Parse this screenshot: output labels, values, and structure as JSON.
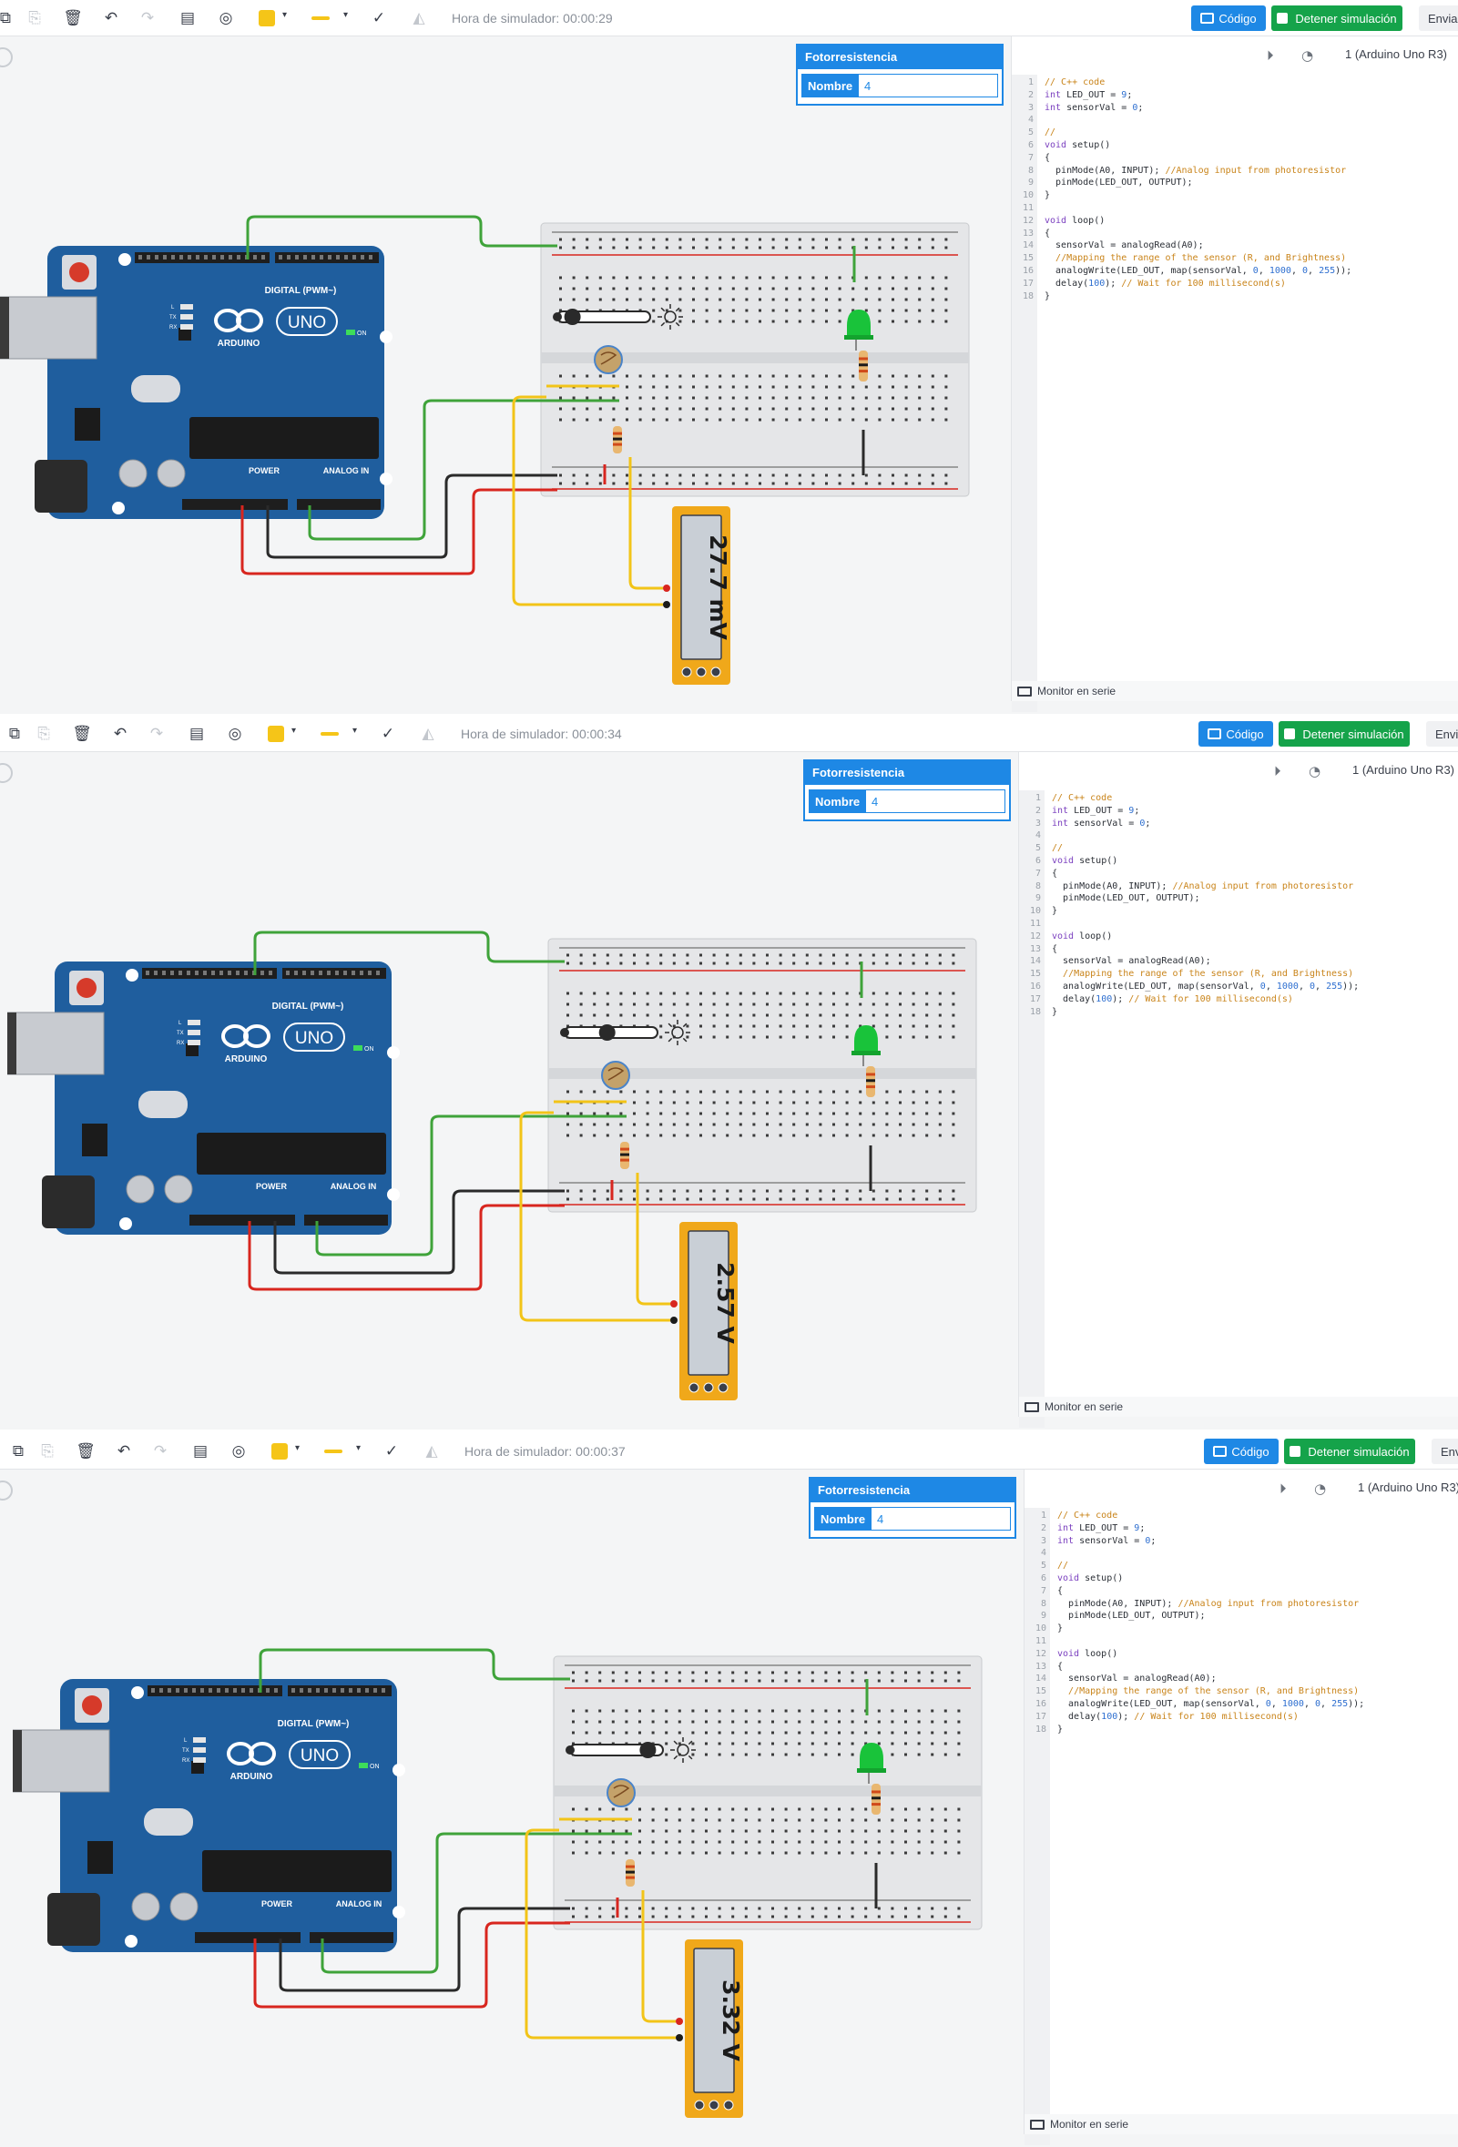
{
  "panels": [
    {
      "sim_time": "Hora de simulador: 00:00:29",
      "meter_reading": "27.7 mV",
      "slider_level": 0.1,
      "led_color": "#19c33a",
      "send_label": "Enviar"
    },
    {
      "sim_time": "Hora de simulador: 00:00:34",
      "meter_reading": "2.57 V",
      "slider_level": 0.45,
      "led_color": "#19c33a",
      "send_label": "Envi"
    },
    {
      "sim_time": "Hora de simulador: 00:00:37",
      "meter_reading": "3.32 V",
      "slider_level": 0.9,
      "led_color": "#19c33a",
      "send_label": "Env"
    }
  ],
  "toolbar": {
    "code_label": "Código",
    "stop_label": "Detener simulación",
    "swatch_color": "#f5c518"
  },
  "properties": {
    "title": "Fotorresistencia",
    "name_label": "Nombre",
    "name_value": "4"
  },
  "code_panel": {
    "device": "1 (Arduino Uno R3)",
    "serial_monitor": "Monitor en serie",
    "lines": [
      "// C++ code",
      "int LED_OUT = 9;",
      "int sensorVal = 0;",
      "",
      "//",
      "void setup()",
      "{",
      "  pinMode(A0, INPUT); //Analog input from photoresistor",
      "  pinMode(LED_OUT, OUTPUT);",
      "}",
      "",
      "void loop()",
      "{",
      "  sensorVal = analogRead(A0);",
      "  //Mapping the range of the sensor (R, and Brightness)",
      "  analogWrite(LED_OUT, map(sensorVal, 0, 1000, 0, 255));",
      "  delay(100); // Wait for 100 millisecond(s)",
      "}"
    ]
  },
  "board": {
    "brand": "ARDUINO",
    "model": "UNO",
    "digital_label": "DIGITAL (PWM~)",
    "power_label": "POWER",
    "analog_label": "ANALOG IN",
    "on_label": "ON",
    "tx_label": "TX",
    "rx_label": "RX",
    "l_label": "L"
  },
  "colors": {
    "board_blue": "#1f5e9e",
    "wire_green": "#3fa33a",
    "wire_yellow": "#f2c418",
    "wire_red": "#d8261f",
    "wire_black": "#2a2a2a",
    "meter_orange": "#f0a81a",
    "accent_blue": "#1e88e5",
    "stop_green": "#15a34a"
  }
}
